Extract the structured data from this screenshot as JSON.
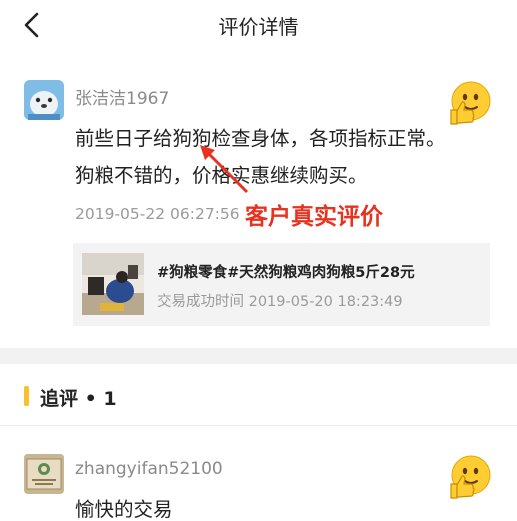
{
  "header": {
    "back_icon": "chevron-left-icon",
    "title": "评价详情"
  },
  "review": {
    "username": "张洁洁1967",
    "avatar_icon": "seal-avatar",
    "rating_icon": "thumbs-up-emoji-icon",
    "text_line1": "前些日子给狗狗检查身体，各项指标正常。",
    "text_line2": "狗粮不错的，价格实惠继续购买。",
    "time": "2019-05-22 06:27:56",
    "annotation": "客户真实评价",
    "annotation_color": "#e8311f"
  },
  "product": {
    "title": "#狗粮零食#天然狗粮鸡肉狗粮5斤28元",
    "deal_label": "交易成功时间 2019-05-20 18:23:49"
  },
  "followup": {
    "title": "追评 • 1",
    "accent_color": "#f6c12b",
    "username": "zhangyifan52100",
    "rating_icon": "thumbs-up-emoji-icon",
    "text": "愉快的交易"
  }
}
